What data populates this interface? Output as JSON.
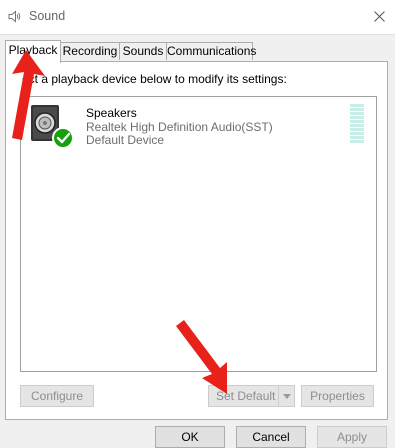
{
  "window": {
    "title": "Sound",
    "icon": "speaker-icon",
    "close_icon": "close-icon"
  },
  "tabs": [
    {
      "label": "Playback",
      "active": true
    },
    {
      "label": "Recording",
      "active": false
    },
    {
      "label": "Sounds",
      "active": false
    },
    {
      "label": "Communications",
      "active": false
    }
  ],
  "panel": {
    "instruction": "ect a playback device below to modify its settings:"
  },
  "device": {
    "name": "Speakers",
    "description": "Realtek High Definition Audio(SST)",
    "status": "Default Device",
    "icon": "speaker-device-icon",
    "badge_icon": "default-check-icon",
    "badge_color": "#13a10e"
  },
  "panel_buttons": {
    "configure": "Configure",
    "set_default": "Set Default",
    "properties": "Properties"
  },
  "dialog_buttons": {
    "ok": "OK",
    "cancel": "Cancel",
    "apply": "Apply"
  },
  "annotations": {
    "arrow_color": "#e8221b"
  },
  "colors": {
    "level_meter": "#c8eee8"
  }
}
